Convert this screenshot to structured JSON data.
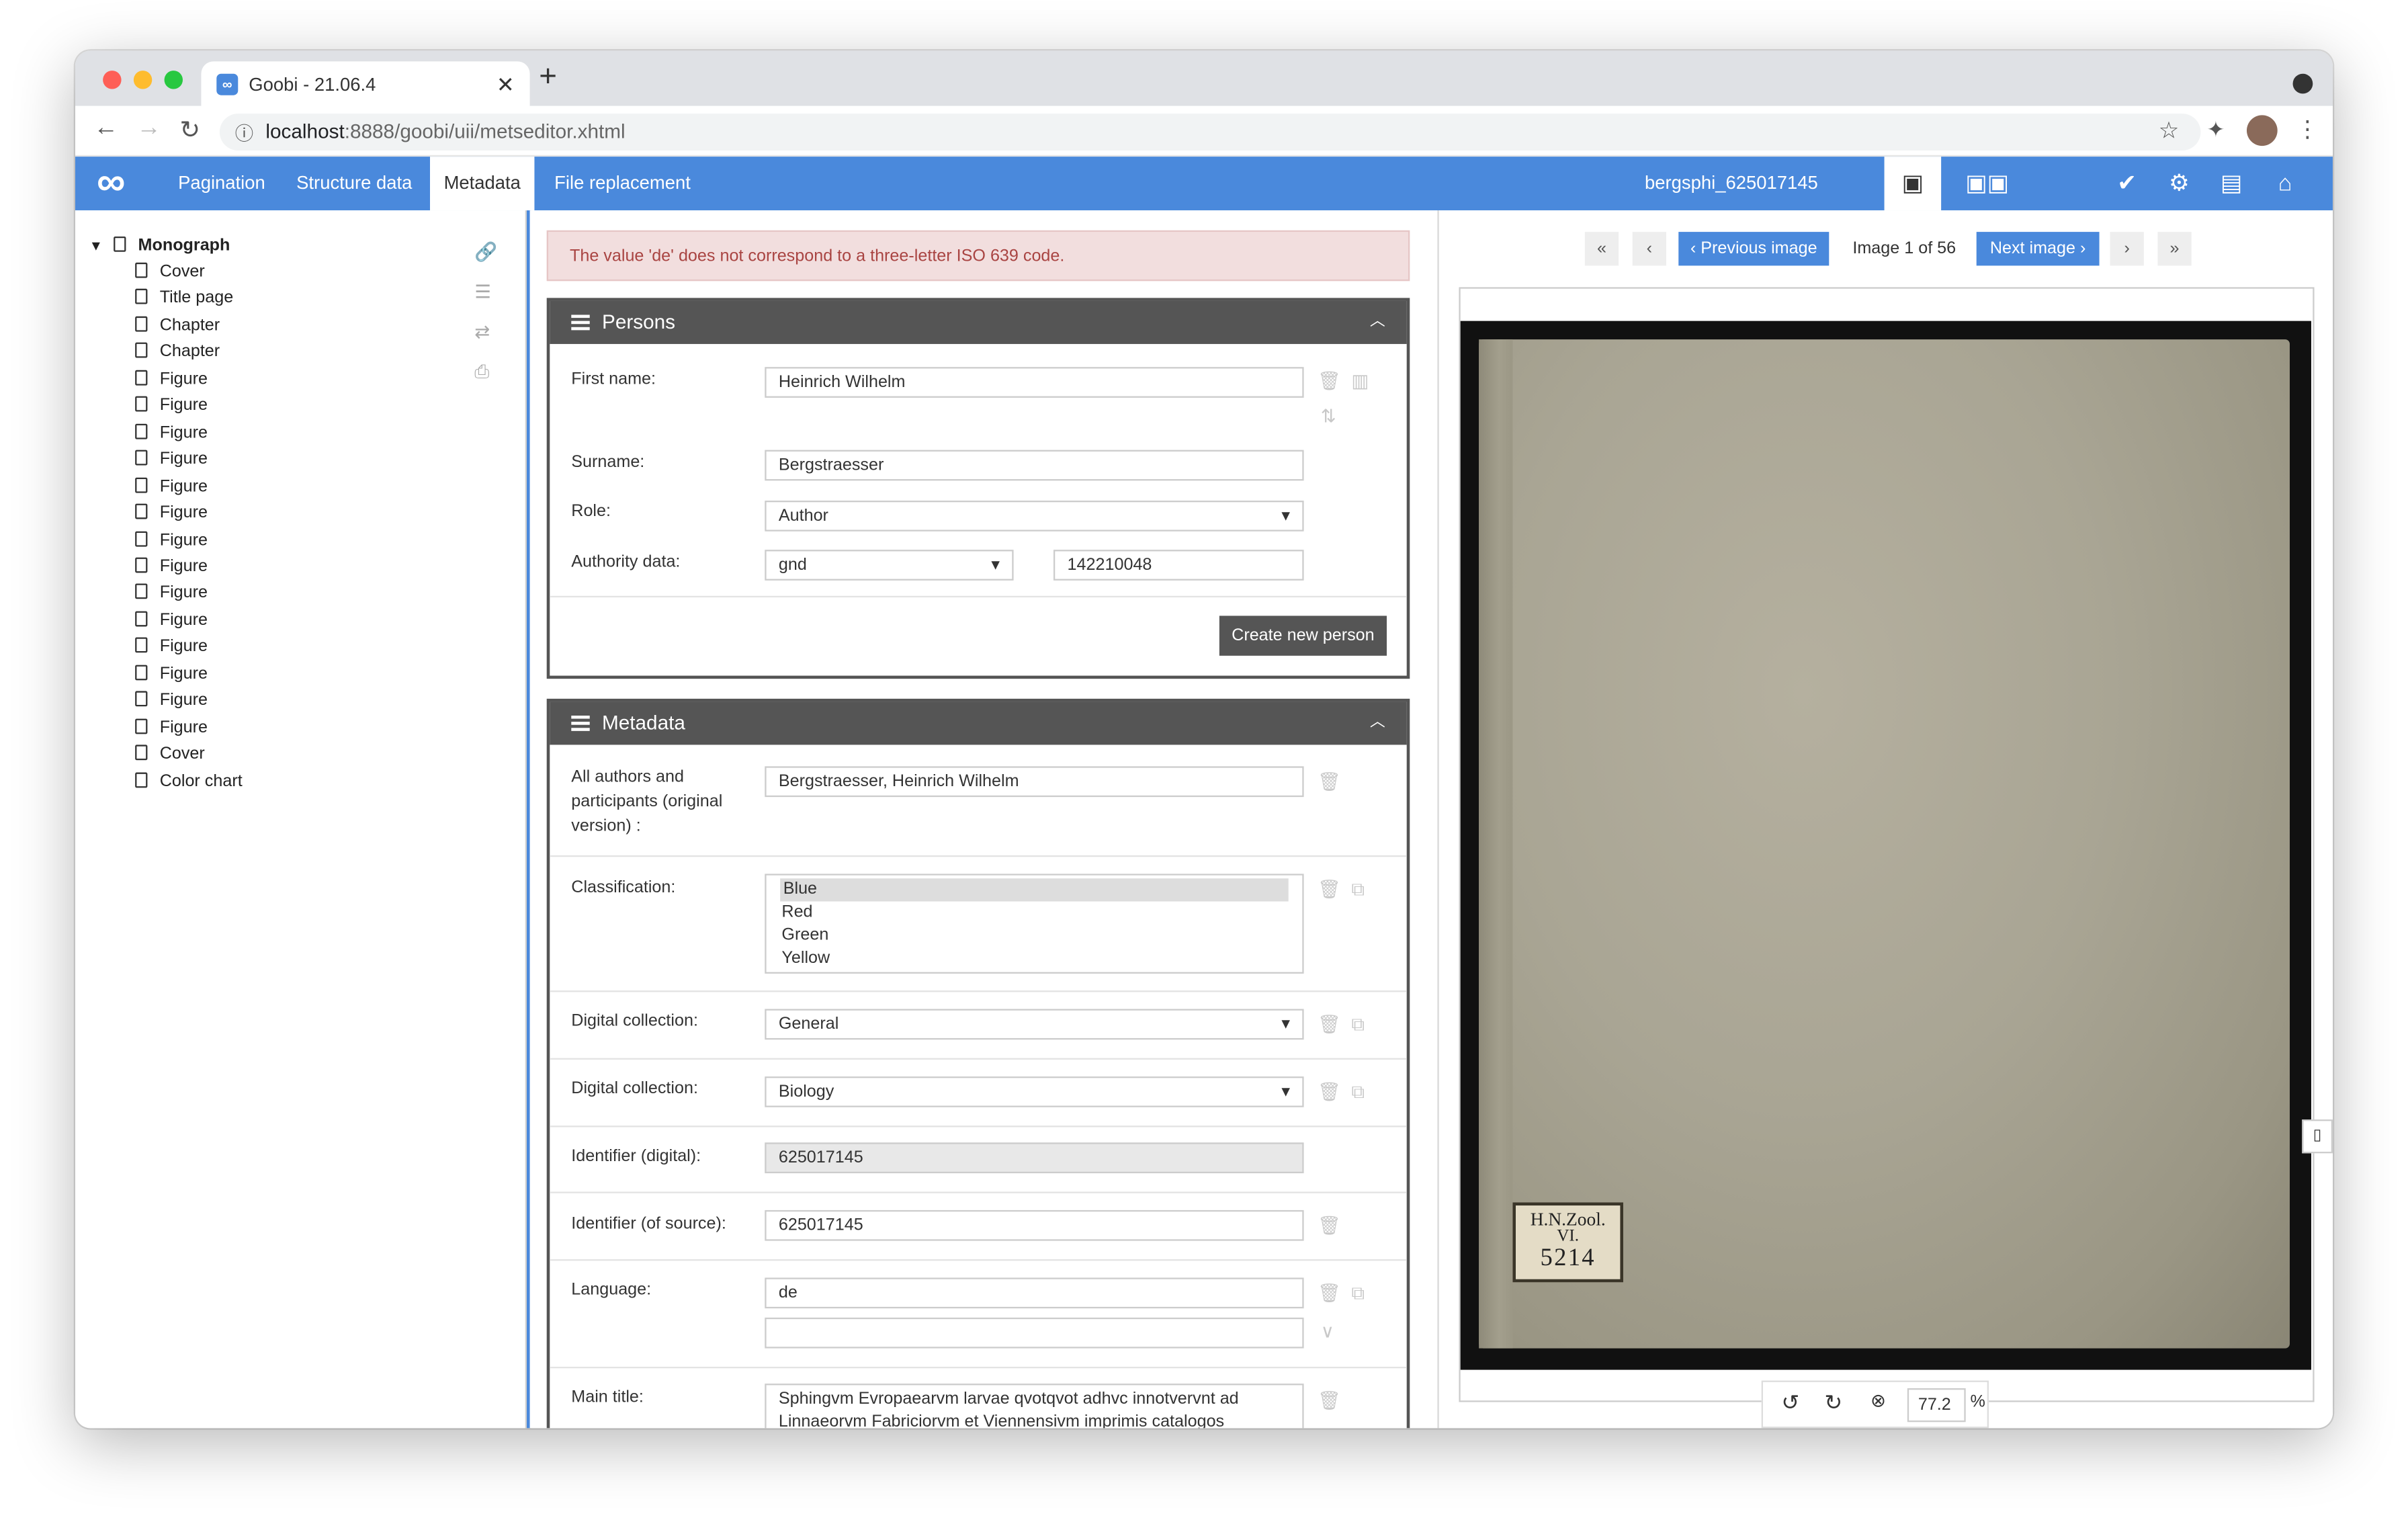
{
  "browser": {
    "tab_title": "Goobi - 21.06.4",
    "favicon": "∞",
    "new_tab": "+",
    "url_host": "localhost",
    "url_path": ":8888/goobi/uii/metseditor.xhtml"
  },
  "app": {
    "logo": "∞",
    "menu": [
      "Pagination",
      "Structure data",
      "Metadata",
      "File replacement"
    ],
    "active_menu": "Metadata",
    "record_title": "bergsphi_625017145",
    "accent": "#4a89dc"
  },
  "tree": {
    "root": "Monograph",
    "items": [
      "Cover",
      "Title page",
      "Chapter",
      "Chapter",
      "Figure",
      "Figure",
      "Figure",
      "Figure",
      "Figure",
      "Figure",
      "Figure",
      "Figure",
      "Figure",
      "Figure",
      "Figure",
      "Figure",
      "Figure",
      "Figure",
      "Cover",
      "Color chart"
    ]
  },
  "alert": {
    "message": "The value 'de' does not correspond to a three-letter ISO 639 code."
  },
  "persons": {
    "heading": "Persons",
    "first_name_label": "First name:",
    "first_name": "Heinrich Wilhelm",
    "surname_label": "Surname:",
    "surname": "Bergstraesser",
    "role_label": "Role:",
    "role": "Author",
    "authority_label": "Authority data:",
    "authority_source": "gnd",
    "authority_id": "142210048",
    "create_button": "Create new person"
  },
  "metadata": {
    "heading": "Metadata",
    "all_authors_label": "All authors and participants (original version) :",
    "all_authors": "Bergstraesser, Heinrich Wilhelm",
    "classification_label": "Classification:",
    "classification_options": [
      "Blue",
      "Red",
      "Green",
      "Yellow"
    ],
    "classification_selected": "Blue",
    "digital_collection_label": "Digital collection:",
    "digital_collection_1": "General",
    "digital_collection_2": "Biology",
    "identifier_digital_label": "Identifier (digital):",
    "identifier_digital": "625017145",
    "identifier_source_label": "Identifier (of source):",
    "identifier_source": "625017145",
    "language_label": "Language:",
    "language": "de",
    "language_2": "",
    "main_title_label": "Main title:",
    "main_title": "Sphingvm Evropaearvm larvae qvotqvot adhvc innotvervnt ad Linnaeorvm Fabriciorvm et Viennensivm imprimis catalogos"
  },
  "viewer": {
    "first": "«",
    "prev_small": "‹",
    "prev_label": "‹ Previous image",
    "page_info": "Image 1 of 56",
    "next_label": "Next image ›",
    "next_small": "›",
    "last": "»",
    "zoom": "77.2",
    "zoom_unit": "%",
    "label_line1": "H.N.Zool.",
    "label_line2": "VI.",
    "label_line3": "5214"
  }
}
